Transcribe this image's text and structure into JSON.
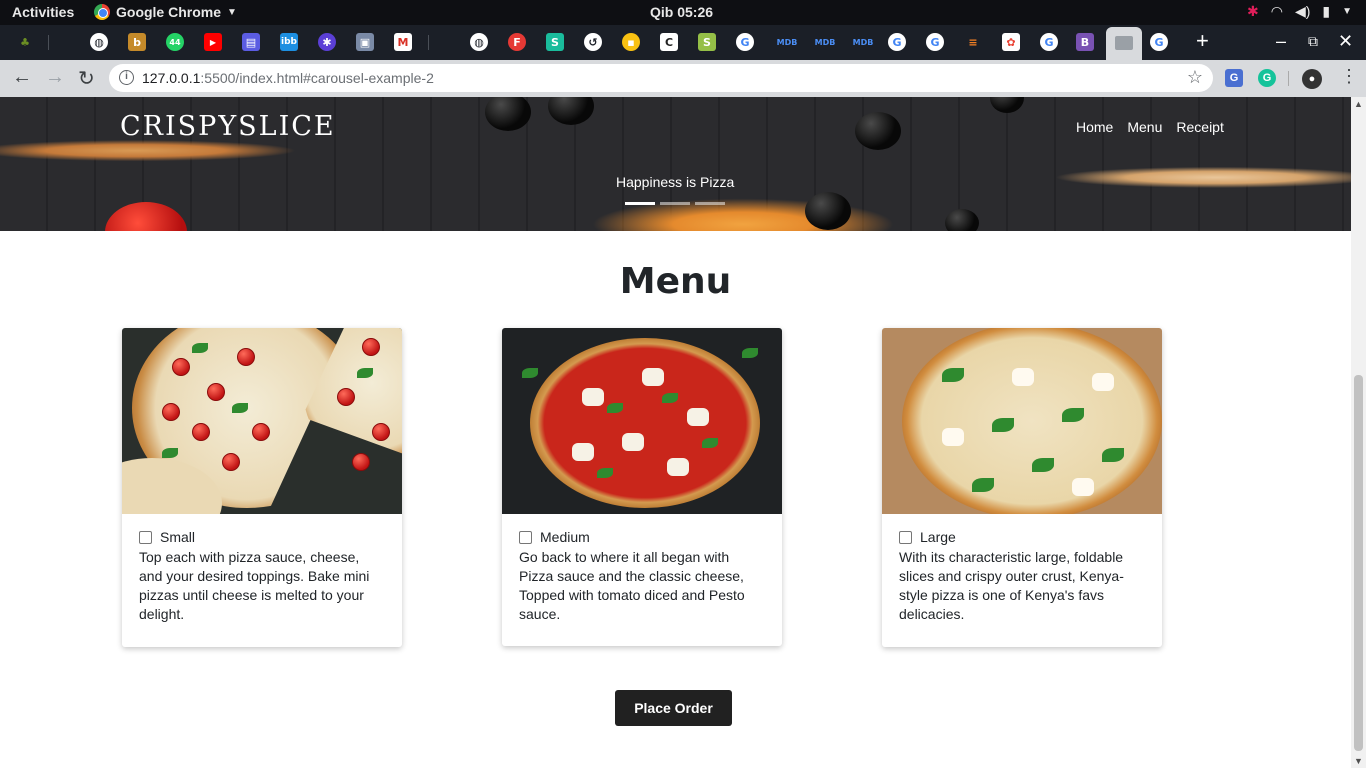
{
  "system_bar": {
    "activities": "Activities",
    "app_name": "Google Chrome",
    "clock": "Qib 05:26"
  },
  "browser": {
    "url_host": "127.0.0.1",
    "url_rest": ":5500/index.html#carousel-example-2"
  },
  "site": {
    "brand": "CRISPYSLICE",
    "nav": [
      "Home",
      "Menu",
      "Receipt"
    ],
    "carousel_caption": "Happiness is Pizza"
  },
  "menu": {
    "title": "Menu",
    "items": [
      {
        "size": "Small",
        "description": "Top each with pizza sauce, cheese, and your desired toppings. Bake mini pizzas until cheese is melted to your delight."
      },
      {
        "size": "Medium",
        "description": "Go back to where it all began with Pizza sauce and the classic cheese, Topped with tomato diced and Pesto sauce."
      },
      {
        "size": "Large",
        "description": "With its characteristic large, foldable slices and crispy outer crust, Kenya-style pizza is one of Kenya's favs delicacies."
      }
    ],
    "order_button": "Place Order"
  }
}
